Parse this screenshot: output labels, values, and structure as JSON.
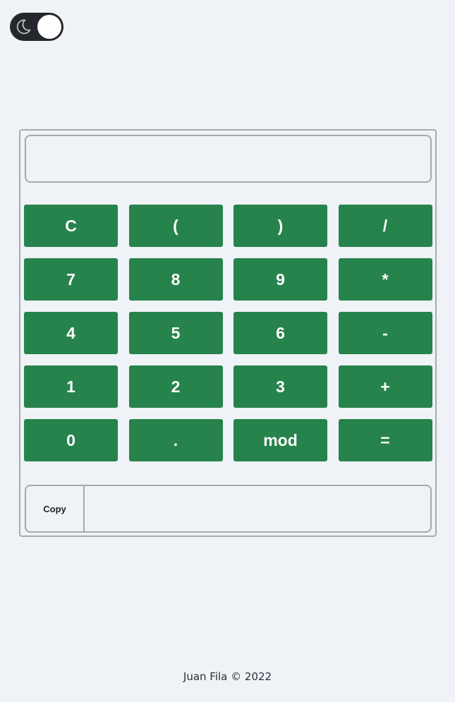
{
  "theme_toggle": {
    "icon": "moon-icon",
    "state": "dark-off"
  },
  "calculator": {
    "display_value": "",
    "keys": [
      {
        "label": "C",
        "name": "clear-button"
      },
      {
        "label": "(",
        "name": "open-paren-button"
      },
      {
        "label": ")",
        "name": "close-paren-button"
      },
      {
        "label": "/",
        "name": "divide-button"
      },
      {
        "label": "7",
        "name": "digit-7-button"
      },
      {
        "label": "8",
        "name": "digit-8-button"
      },
      {
        "label": "9",
        "name": "digit-9-button"
      },
      {
        "label": "*",
        "name": "multiply-button"
      },
      {
        "label": "4",
        "name": "digit-4-button"
      },
      {
        "label": "5",
        "name": "digit-5-button"
      },
      {
        "label": "6",
        "name": "digit-6-button"
      },
      {
        "label": "-",
        "name": "subtract-button"
      },
      {
        "label": "1",
        "name": "digit-1-button"
      },
      {
        "label": "2",
        "name": "digit-2-button"
      },
      {
        "label": "3",
        "name": "digit-3-button"
      },
      {
        "label": "+",
        "name": "add-button"
      },
      {
        "label": "0",
        "name": "digit-0-button"
      },
      {
        "label": ".",
        "name": "decimal-button"
      },
      {
        "label": "mod",
        "name": "mod-button"
      },
      {
        "label": "=",
        "name": "equals-button"
      }
    ],
    "copy_label": "Copy",
    "result_value": ""
  },
  "colors": {
    "background": "#eff3f8",
    "key_green": "#26834b",
    "border_gray": "#a6a9ad",
    "toggle_dark": "#24272c"
  },
  "footer": {
    "text": "Juan Fila © 2022"
  }
}
